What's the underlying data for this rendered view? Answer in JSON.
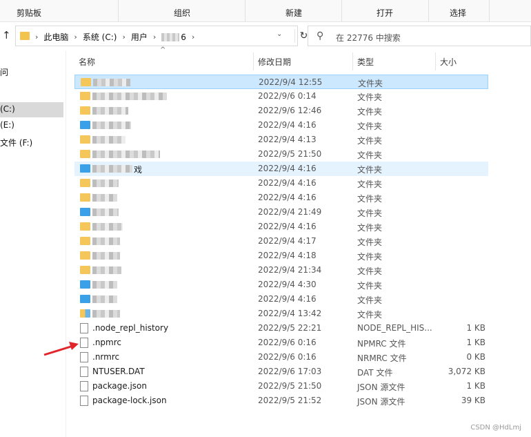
{
  "ribbon": {
    "groups": [
      "剪贴板",
      "组织",
      "新建",
      "打开",
      "选择"
    ]
  },
  "address": {
    "crumbs": [
      "此电脑",
      "系统 (C:)",
      "用户"
    ],
    "blurred_tail": "6",
    "search_placeholder": "在 22776 中搜索"
  },
  "nav": {
    "items": [
      "问",
      "(C:)",
      "(E:)",
      "文件 (F:)"
    ]
  },
  "columns": {
    "name": "名称",
    "date": "修改日期",
    "type": "类型",
    "size": "大小"
  },
  "folders": [
    {
      "date": "2022/9/4 12:55",
      "type": "文件夹",
      "state": "selected"
    },
    {
      "date": "2022/9/6 0:14",
      "type": "文件夹"
    },
    {
      "date": "2022/9/6 12:46",
      "type": "文件夹"
    },
    {
      "date": "2022/9/4 4:16",
      "type": "文件夹"
    },
    {
      "date": "2022/9/4 4:13",
      "type": "文件夹"
    },
    {
      "date": "2022/9/5 21:50",
      "type": "文件夹"
    },
    {
      "date": "2022/9/4 4:16",
      "type": "文件夹",
      "state": "hover",
      "name_fragment": "戏"
    },
    {
      "date": "2022/9/4 4:16",
      "type": "文件夹"
    },
    {
      "date": "2022/9/4 4:16",
      "type": "文件夹"
    },
    {
      "date": "2022/9/4 21:49",
      "type": "文件夹"
    },
    {
      "date": "2022/9/4 4:16",
      "type": "文件夹"
    },
    {
      "date": "2022/9/4 4:17",
      "type": "文件夹"
    },
    {
      "date": "2022/9/4 4:18",
      "type": "文件夹"
    },
    {
      "date": "2022/9/4 21:34",
      "type": "文件夹"
    },
    {
      "date": "2022/9/4 4:30",
      "type": "文件夹"
    },
    {
      "date": "2022/9/4 4:16",
      "type": "文件夹"
    },
    {
      "date": "2022/9/4 13:42",
      "type": "文件夹"
    }
  ],
  "files": [
    {
      "name": ".node_repl_history",
      "date": "2022/9/5 22:21",
      "type": "NODE_REPL_HIS...",
      "size": "1 KB"
    },
    {
      "name": ".npmrc",
      "date": "2022/9/6 0:16",
      "type": "NPMRC 文件",
      "size": "1 KB"
    },
    {
      "name": ".nrmrc",
      "date": "2022/9/6 0:16",
      "type": "NRMRC 文件",
      "size": "0 KB"
    },
    {
      "name": "NTUSER.DAT",
      "date": "2022/9/6 17:03",
      "type": "DAT 文件",
      "size": "3,072 KB"
    },
    {
      "name": "package.json",
      "date": "2022/9/5 21:50",
      "type": "JSON 源文件",
      "size": "1 KB"
    },
    {
      "name": "package-lock.json",
      "date": "2022/9/5 21:52",
      "type": "JSON 源文件",
      "size": "39 KB"
    }
  ],
  "watermark": "CSDN @HdLmj",
  "colors": {
    "selected_bg": "#cce8ff",
    "hover_bg": "#e5f3ff",
    "arrow": "#e0252b"
  }
}
